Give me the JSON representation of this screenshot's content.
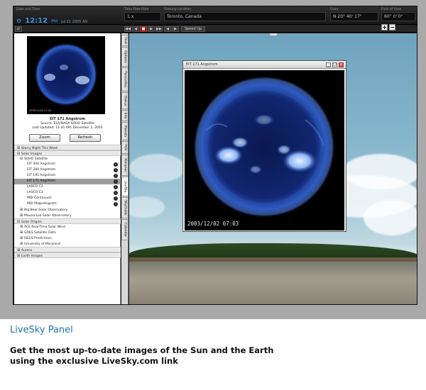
{
  "topbar": {
    "date_label": "Date and Time",
    "clock_time": "12:12",
    "clock_ampm": "PM",
    "clock_date": "Jul 21 2005 AD",
    "timeflow_label": "Time Flow Rate",
    "timeflow_value": "1 x",
    "viewing_label": "Viewing Location",
    "viewing_value": "Toronto, Canada",
    "gaze_label": "Gaze",
    "gaze_value": "N 20° 40' 17\"",
    "fov_label": "Field of View",
    "fov_value": "60° 0' 0\"",
    "now_label": "Now",
    "speed_label": "Speed Up",
    "plus_label": "+",
    "minus_label": "−"
  },
  "left_panel": {
    "thumb_stamp": "2003/12/02 07:03",
    "caption_title": "EIT 171 Angstrom",
    "caption_source": "Source: ESA/NASA SOHO Satellite",
    "caption_updated": "Last Updated: 11:41 AM, December 2, 2003",
    "zoom_button": "Zoom",
    "refresh_button": "Refresh",
    "tree": {
      "starry": "Starry Night This Week",
      "solar_images": "Solar Images",
      "soho": "SOHO Satellite",
      "eit304": "EIT 304 Angstrom",
      "eit284": "EIT 284 Angstrom",
      "eit195": "EIT 195 Angstrom",
      "eit171": "EIT 171 Angstrom",
      "lascoc2": "LASCO C2",
      "lascoc3": "LASCO C3",
      "mdicont": "MDI Continuum",
      "mdimag": "MDI Magnetogram",
      "bigbear": "Big Bear Solar Observatory",
      "maunaloa": "Mauna Loa Solar Observatory",
      "solar_origins": "Solar Origins",
      "ace": "ACE Real-Time Solar Wind",
      "goes": "GOES Satellite Data",
      "isees": "ISEES Predictions",
      "umd": "University of Maryland",
      "aurora": "Aurora",
      "earth": "Earth Images"
    }
  },
  "tabs": [
    "Find",
    "Options",
    "Favourites",
    "Status",
    "Info",
    "Planets",
    "FOV",
    "Almanac",
    "LiveSky",
    "SkyGuide",
    "Calendar"
  ],
  "image_window": {
    "title": "EIT 171 Angstrom",
    "timestamp": "2003/12/02  07:03"
  },
  "footer": {
    "title": "LiveSky Panel",
    "description_line1": "Get the most up-to-date images of the Sun and the Earth",
    "description_line2": "using the exclusive LiveSky.com link"
  },
  "colors": {
    "footer_title": "#2472b8",
    "clock": "#3f8fe6",
    "sun_glow": "#3a6cd0"
  }
}
